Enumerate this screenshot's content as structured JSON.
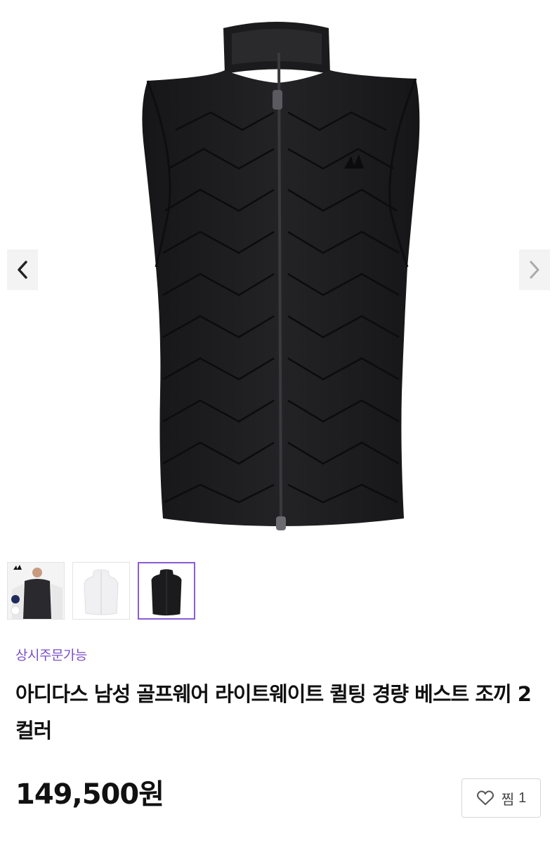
{
  "gallery": {
    "main_image": "black-quilted-vest",
    "prev_icon": "chevron-left-icon",
    "next_icon": "chevron-right-icon",
    "thumbnails": [
      {
        "image": "model-wearing-navy-vest",
        "active": false
      },
      {
        "image": "white-vest",
        "active": false
      },
      {
        "image": "black-vest",
        "active": true
      }
    ]
  },
  "product": {
    "tag": "상시주문가능",
    "title": "아디다스 남성 골프웨어 라이트웨이트 퀼팅 경량 베스트 조끼 2컬러",
    "price": "149,500원"
  },
  "wish": {
    "icon": "heart-icon",
    "label": "찜",
    "count": "1"
  },
  "colors": {
    "accent": "#7b4fc6",
    "active_thumb_border": "#8a5cd6",
    "vest": "#1a1a1c"
  }
}
